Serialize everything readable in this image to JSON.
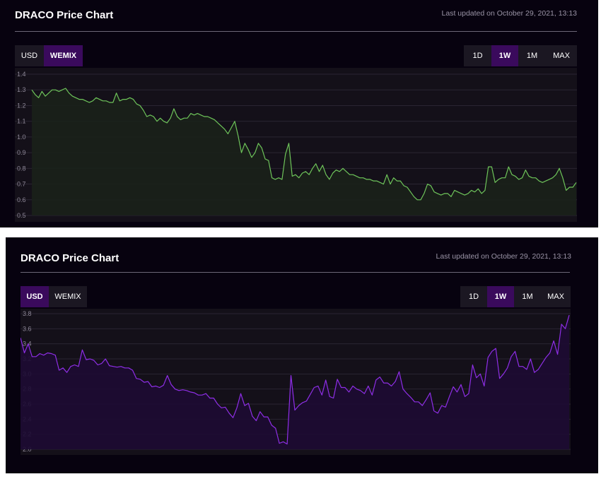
{
  "panels": [
    {
      "title": "DRACO Price Chart",
      "updated": "Last updated on October 29, 2021, 13:13",
      "currency_buttons": [
        "USD",
        "WEMIX"
      ],
      "currency_active": 1,
      "range_buttons": [
        "1D",
        "1W",
        "1M",
        "MAX"
      ],
      "range_active": 1,
      "colors": {
        "line": "#6ec45a",
        "fill": "#1a2119",
        "active_button": "#3a0a5c"
      }
    },
    {
      "title": "DRACO Price Chart",
      "updated": "Last updated on October 29, 2021, 13:13",
      "currency_buttons": [
        "USD",
        "WEMIX"
      ],
      "currency_active": 0,
      "range_buttons": [
        "1D",
        "1W",
        "1M",
        "MAX"
      ],
      "range_active": 1,
      "colors": {
        "line": "#8e2ee6",
        "fill": "#1d0b33",
        "active_button": "#3a0a5c"
      }
    }
  ],
  "chart_data": [
    {
      "type": "area",
      "series_unit": "WEMIX",
      "ylim": [
        0.5,
        1.4
      ],
      "yticks": [
        "1.4",
        "1.3",
        "1.2",
        "1.1",
        "1.0",
        "0.9",
        "0.8",
        "0.7",
        "0.6",
        "0.5"
      ],
      "grid": true,
      "values": [
        1.3,
        1.27,
        1.25,
        1.29,
        1.26,
        1.28,
        1.3,
        1.3,
        1.29,
        1.3,
        1.31,
        1.28,
        1.26,
        1.25,
        1.24,
        1.24,
        1.23,
        1.22,
        1.23,
        1.25,
        1.24,
        1.23,
        1.23,
        1.22,
        1.22,
        1.28,
        1.23,
        1.24,
        1.24,
        1.25,
        1.24,
        1.21,
        1.2,
        1.17,
        1.13,
        1.14,
        1.13,
        1.1,
        1.12,
        1.1,
        1.09,
        1.12,
        1.18,
        1.13,
        1.11,
        1.12,
        1.12,
        1.15,
        1.14,
        1.15,
        1.14,
        1.13,
        1.13,
        1.12,
        1.11,
        1.09,
        1.07,
        1.05,
        1.02,
        1.06,
        1.1,
        1.01,
        0.9,
        0.96,
        0.92,
        0.87,
        0.9,
        0.96,
        0.93,
        0.86,
        0.85,
        0.74,
        0.73,
        0.74,
        0.73,
        0.89,
        0.96,
        0.75,
        0.76,
        0.74,
        0.77,
        0.78,
        0.76,
        0.8,
        0.83,
        0.78,
        0.82,
        0.76,
        0.73,
        0.77,
        0.79,
        0.78,
        0.8,
        0.78,
        0.76,
        0.76,
        0.75,
        0.74,
        0.74,
        0.73,
        0.73,
        0.72,
        0.72,
        0.71,
        0.7,
        0.76,
        0.7,
        0.74,
        0.72,
        0.72,
        0.69,
        0.68,
        0.65,
        0.62,
        0.6,
        0.6,
        0.64,
        0.7,
        0.69,
        0.65,
        0.64,
        0.63,
        0.64,
        0.64,
        0.62,
        0.66,
        0.65,
        0.64,
        0.63,
        0.64,
        0.66,
        0.65,
        0.67,
        0.64,
        0.66,
        0.81,
        0.81,
        0.71,
        0.73,
        0.74,
        0.74,
        0.81,
        0.76,
        0.75,
        0.73,
        0.74,
        0.79,
        0.75,
        0.74,
        0.74,
        0.72,
        0.71,
        0.72,
        0.73,
        0.74,
        0.76,
        0.8,
        0.74,
        0.66,
        0.68,
        0.68,
        0.71
      ]
    },
    {
      "type": "area",
      "series_unit": "USD",
      "ylim": [
        2.0,
        3.8
      ],
      "yticks": [
        "3.8",
        "3.6",
        "3.4",
        "3.2",
        "3.0",
        "2.8",
        "2.6",
        "2.4",
        "2.2",
        "2.0"
      ],
      "grid": true,
      "values": [
        3.48,
        3.28,
        3.4,
        3.23,
        3.23,
        3.27,
        3.25,
        3.28,
        3.27,
        3.25,
        3.05,
        3.08,
        3.02,
        3.1,
        3.12,
        3.1,
        3.32,
        3.19,
        3.2,
        3.18,
        3.12,
        3.14,
        3.2,
        3.11,
        3.1,
        3.09,
        3.1,
        3.08,
        3.08,
        3.05,
        2.94,
        2.93,
        2.89,
        2.9,
        2.83,
        2.84,
        2.82,
        2.85,
        2.98,
        2.86,
        2.8,
        2.78,
        2.79,
        2.78,
        2.76,
        2.75,
        2.72,
        2.72,
        2.74,
        2.68,
        2.68,
        2.6,
        2.55,
        2.56,
        2.48,
        2.42,
        2.55,
        2.74,
        2.58,
        2.61,
        2.44,
        2.38,
        2.5,
        2.43,
        2.43,
        2.32,
        2.28,
        2.08,
        2.1,
        2.07,
        2.98,
        2.52,
        2.58,
        2.62,
        2.64,
        2.73,
        2.82,
        2.84,
        2.72,
        2.92,
        2.7,
        2.68,
        2.93,
        2.82,
        2.82,
        2.76,
        2.84,
        2.8,
        2.78,
        2.74,
        2.84,
        2.72,
        2.92,
        2.96,
        2.88,
        2.88,
        2.84,
        2.9,
        3.03,
        2.8,
        2.74,
        2.69,
        2.63,
        2.63,
        2.58,
        2.66,
        2.75,
        2.51,
        2.48,
        2.58,
        2.56,
        2.7,
        2.83,
        2.76,
        2.86,
        2.7,
        2.74,
        3.12,
        2.95,
        3.0,
        2.84,
        3.22,
        3.3,
        3.34,
        2.94,
        3.0,
        3.08,
        3.23,
        3.3,
        3.1,
        3.1,
        3.06,
        3.2,
        3.02,
        3.06,
        3.14,
        3.22,
        3.28,
        3.44,
        3.26,
        3.66,
        3.6,
        3.78
      ]
    }
  ]
}
